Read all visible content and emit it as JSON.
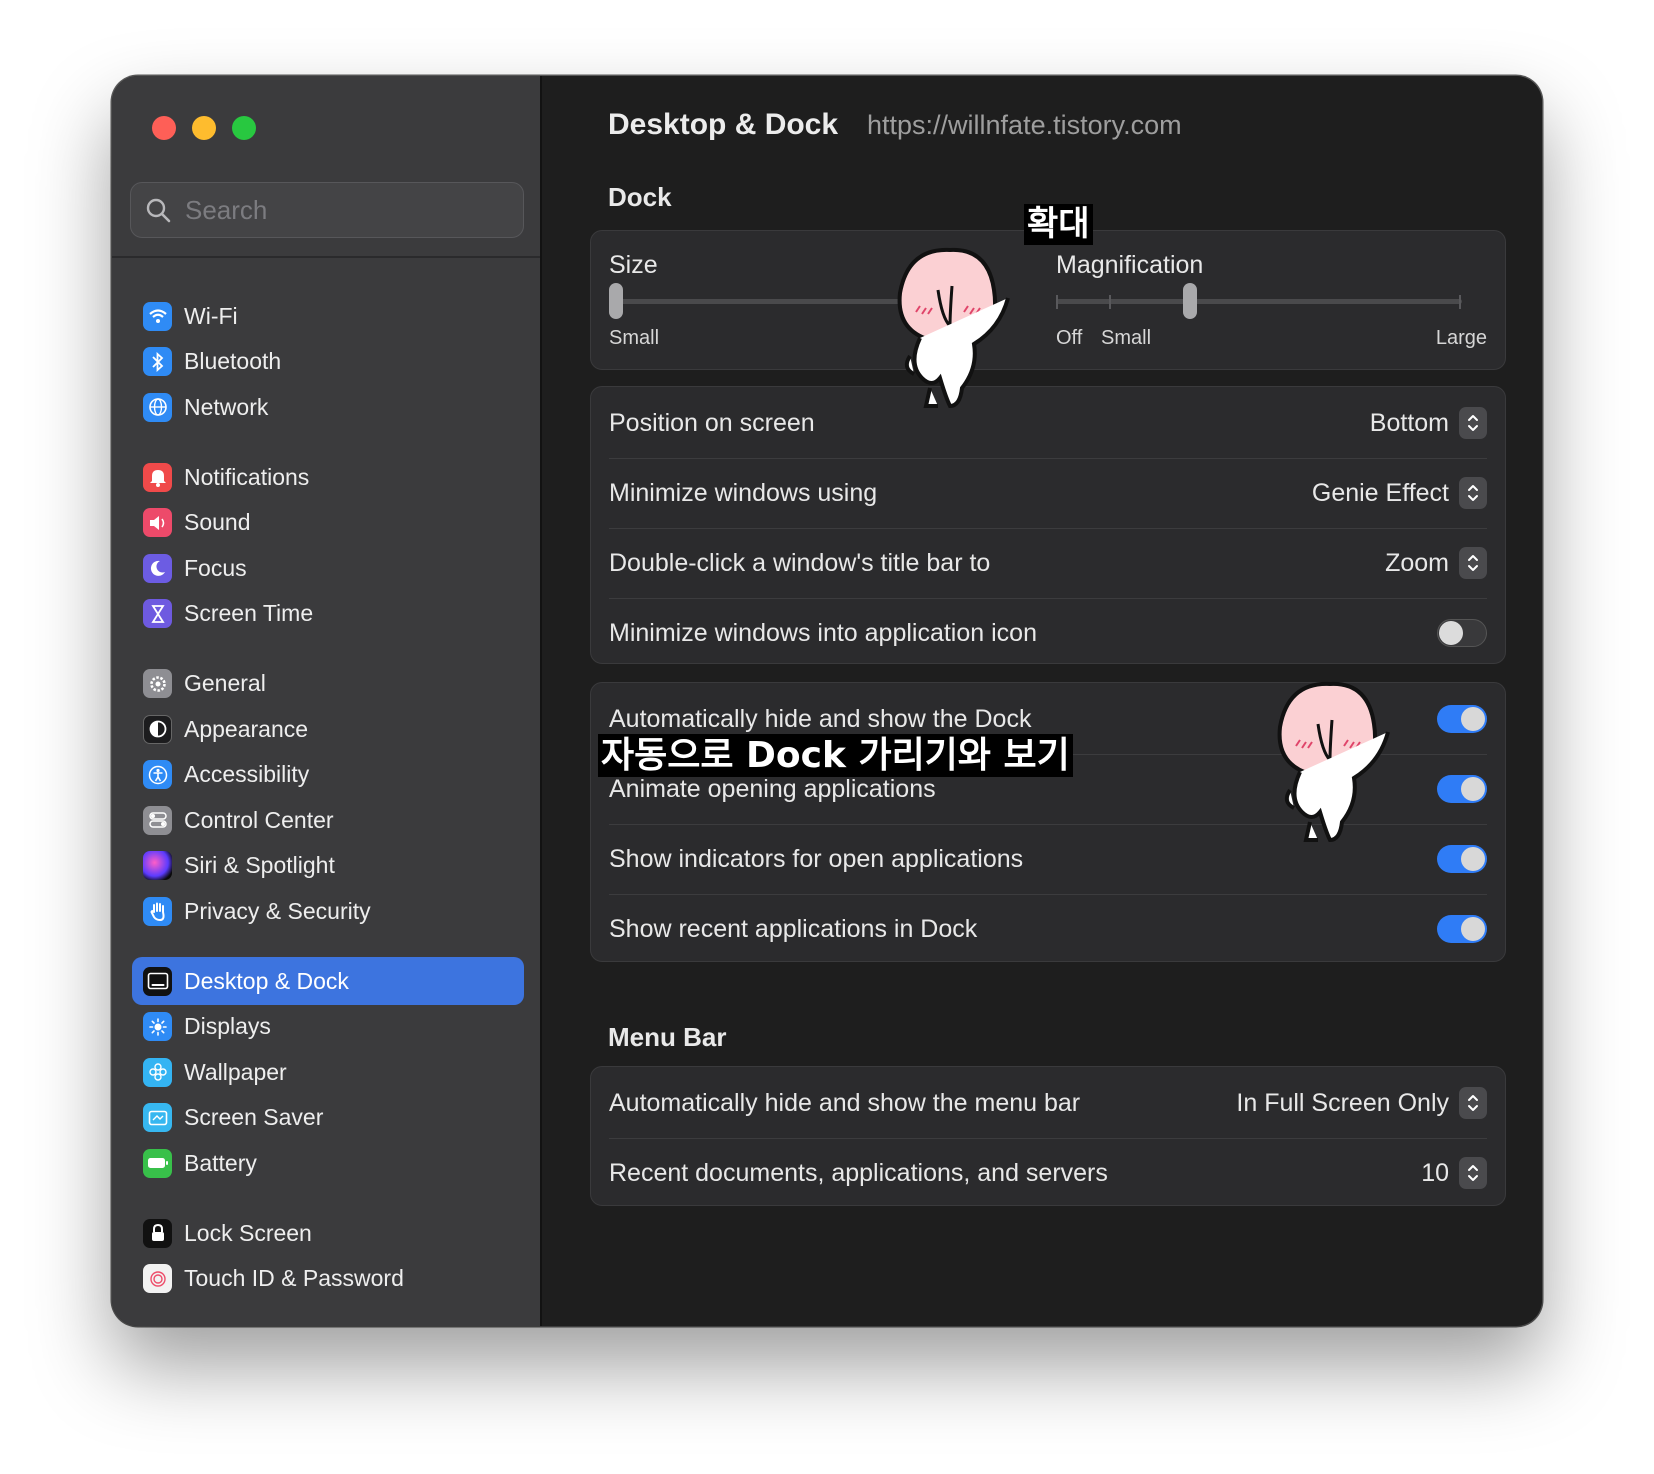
{
  "window": {
    "traffic_lights": [
      "close",
      "minimize",
      "zoom"
    ]
  },
  "search": {
    "placeholder": "Search"
  },
  "sidebar": {
    "items": [
      {
        "label": "Wi-Fi",
        "icon": "wifi-icon"
      },
      {
        "label": "Bluetooth",
        "icon": "bluetooth-icon"
      },
      {
        "label": "Network",
        "icon": "globe-icon"
      },
      {
        "label": "Notifications",
        "icon": "bell-icon"
      },
      {
        "label": "Sound",
        "icon": "speaker-icon"
      },
      {
        "label": "Focus",
        "icon": "moon-icon"
      },
      {
        "label": "Screen Time",
        "icon": "hourglass-icon"
      },
      {
        "label": "General",
        "icon": "gear-icon"
      },
      {
        "label": "Appearance",
        "icon": "appearance-icon"
      },
      {
        "label": "Accessibility",
        "icon": "accessibility-icon"
      },
      {
        "label": "Control Center",
        "icon": "toggles-icon"
      },
      {
        "label": "Siri & Spotlight",
        "icon": "siri-icon"
      },
      {
        "label": "Privacy & Security",
        "icon": "hand-icon"
      },
      {
        "label": "Desktop & Dock",
        "icon": "dock-icon",
        "selected": true
      },
      {
        "label": "Displays",
        "icon": "sun-icon"
      },
      {
        "label": "Wallpaper",
        "icon": "flower-icon"
      },
      {
        "label": "Screen Saver",
        "icon": "screensaver-icon"
      },
      {
        "label": "Battery",
        "icon": "battery-icon"
      },
      {
        "label": "Lock Screen",
        "icon": "lock-icon"
      },
      {
        "label": "Touch ID & Password",
        "icon": "fingerprint-icon"
      }
    ]
  },
  "header": {
    "title": "Desktop & Dock",
    "url": "https://willnfate.tistory.com"
  },
  "dock": {
    "section_title": "Dock",
    "size": {
      "label": "Size",
      "min_label": "Small",
      "value": 0.0
    },
    "magnification": {
      "label": "Magnification",
      "annotation": "확대",
      "tick_labels": [
        "Off",
        "Small",
        "Large"
      ],
      "value": 0.32
    },
    "settings": [
      {
        "label": "Position on screen",
        "value": "Bottom"
      },
      {
        "label": "Minimize windows using",
        "value": "Genie Effect"
      },
      {
        "label": "Double-click a window's title bar to",
        "value": "Zoom"
      },
      {
        "label": "Minimize windows into application icon",
        "toggle": false
      }
    ],
    "toggles": [
      {
        "label": "Automatically hide and show the Dock",
        "on": true
      },
      {
        "label": "Animate opening applications",
        "on": true
      },
      {
        "label": "Show indicators for open applications",
        "on": true
      },
      {
        "label": "Show recent applications in Dock",
        "on": true
      }
    ],
    "annotation_autohide": "자동으로 Dock 가리기와 보기"
  },
  "menu_bar": {
    "section_title": "Menu Bar",
    "settings": [
      {
        "label": "Automatically hide and show the menu bar",
        "value": "In Full Screen Only"
      },
      {
        "label": "Recent documents, applications, and servers",
        "value": "10"
      }
    ]
  },
  "colors": {
    "accent": "#3d74df",
    "toggle_on": "#2f7cf6",
    "window_bg": "#1e1e1e",
    "sidebar_bg": "#3b3b3d",
    "card_bg": "#2b2b2d"
  }
}
